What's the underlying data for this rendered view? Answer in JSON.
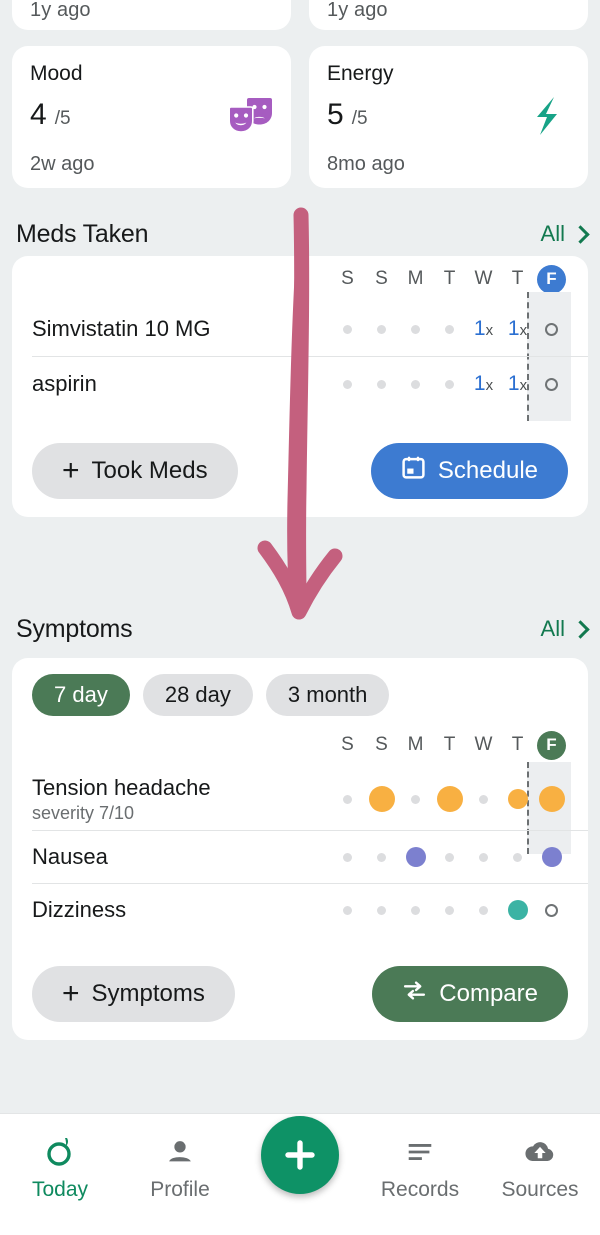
{
  "colors": {
    "background": "#eceff0",
    "card": "#ffffff",
    "green_accent": "#0f8a5f",
    "green_link": "#12794f",
    "green_chip": "#4b7a56",
    "blue": "#3d7bd1",
    "orange_dot": "#f8b042",
    "purple_dot": "#7c80cf",
    "teal_dot": "#3bb3a4",
    "grey_dot": "#dcdddf",
    "annotation_arrow": "#c4607e",
    "mood_icon": "#a65cc0"
  },
  "top_partial_cards": [
    {
      "ago": "1y ago"
    },
    {
      "ago": "1y ago"
    }
  ],
  "metrics": [
    {
      "title": "Mood",
      "value": "4",
      "max": "/5",
      "ago": "2w ago",
      "icon": "theater-masks-icon"
    },
    {
      "title": "Energy",
      "value": "5",
      "max": "/5",
      "ago": "8mo ago",
      "icon": "lightning-bolt-icon"
    }
  ],
  "meds": {
    "section_title": "Meds Taken",
    "all_label": "All",
    "days": [
      "S",
      "S",
      "M",
      "T",
      "W",
      "T",
      "F"
    ],
    "today_index": 6,
    "today_letter": "F",
    "rows": [
      {
        "name": "Simvistatin 10 MG",
        "cells": [
          "dot",
          "dot",
          "dot",
          "dot",
          "1x",
          "1x",
          "ring"
        ]
      },
      {
        "name": "aspirin",
        "cells": [
          "dot",
          "dot",
          "dot",
          "dot",
          "1x",
          "1x",
          "ring"
        ]
      }
    ],
    "dose_label": "1",
    "dose_suffix": "x",
    "took_meds_label": "Took Meds",
    "schedule_label": "Schedule"
  },
  "symptoms": {
    "section_title": "Symptoms",
    "all_label": "All",
    "ranges": [
      {
        "label": "7 day",
        "active": true
      },
      {
        "label": "28 day",
        "active": false
      },
      {
        "label": "3 month",
        "active": false
      }
    ],
    "days": [
      "S",
      "S",
      "M",
      "T",
      "W",
      "T",
      "F"
    ],
    "today_index": 6,
    "today_letter": "F",
    "rows": [
      {
        "name": "Tension headache",
        "sub": "severity 7/10",
        "color": "orange",
        "cells": [
          "none",
          "lg",
          "none",
          "lg",
          "none",
          "md",
          "lg"
        ]
      },
      {
        "name": "Nausea",
        "sub": "",
        "color": "purple",
        "cells": [
          "none",
          "none",
          "md",
          "none",
          "none",
          "none",
          "md"
        ]
      },
      {
        "name": "Dizziness",
        "sub": "",
        "color": "teal",
        "cells": [
          "none",
          "none",
          "none",
          "none",
          "none",
          "md",
          "ring"
        ]
      }
    ],
    "add_label": "Symptoms",
    "compare_label": "Compare"
  },
  "bottom_nav": [
    {
      "label": "Today",
      "icon": "leaf-ring-icon",
      "active": true
    },
    {
      "label": "Profile",
      "icon": "person-icon",
      "active": false
    },
    {
      "label": "",
      "icon": "plus-fab-icon",
      "active": false
    },
    {
      "label": "Records",
      "icon": "list-lines-icon",
      "active": false
    },
    {
      "label": "Sources",
      "icon": "cloud-upload-icon",
      "active": false
    }
  ],
  "annotation": {
    "type": "down-arrow",
    "color": "#c4607e"
  }
}
